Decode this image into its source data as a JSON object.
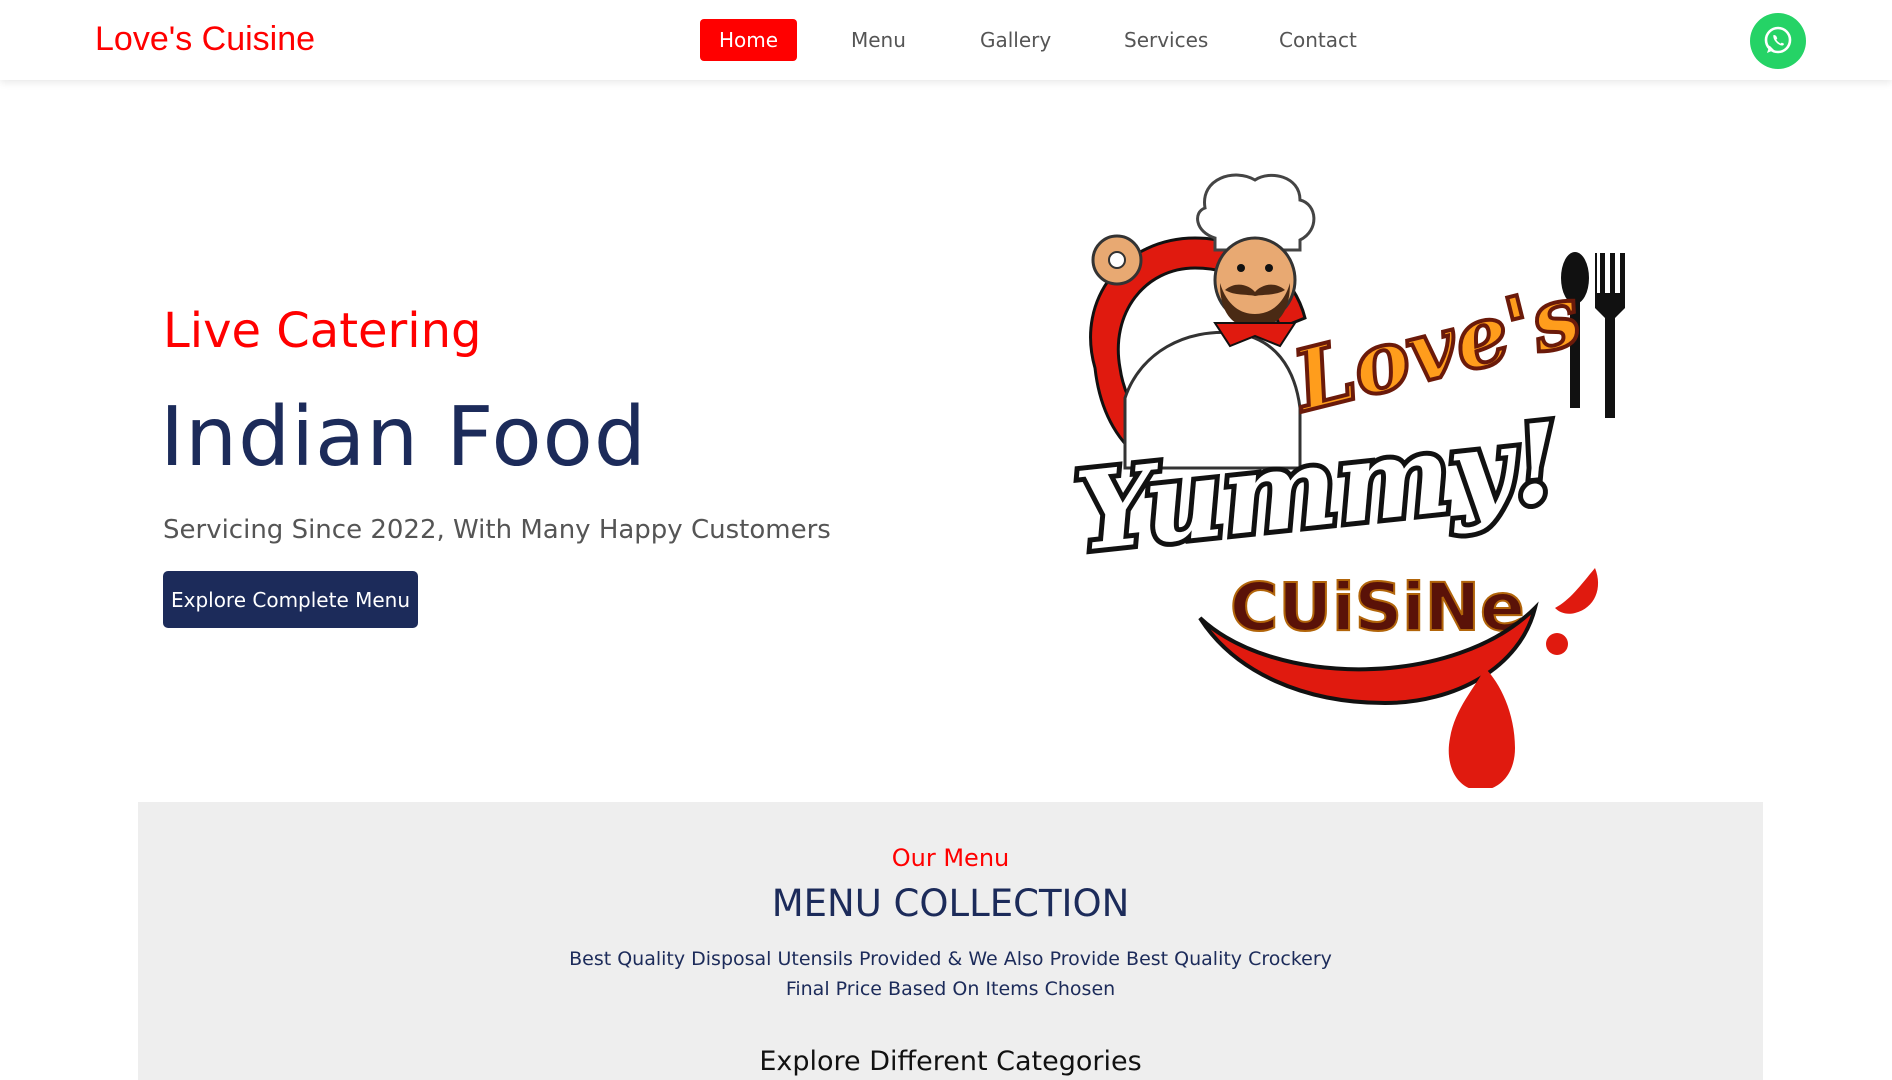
{
  "header": {
    "brand": "Love's Cuisine",
    "nav": [
      {
        "label": "Home",
        "active": true
      },
      {
        "label": "Menu",
        "active": false
      },
      {
        "label": "Gallery",
        "active": false
      },
      {
        "label": "Services",
        "active": false
      },
      {
        "label": "Contact",
        "active": false
      }
    ],
    "contact_icon": "whatsapp-icon"
  },
  "hero": {
    "subtitle": "Live Catering",
    "title": "Indian Food",
    "tagline": "Servicing Since 2022, With Many Happy Customers",
    "cta_label": "Explore Complete Menu",
    "logo": {
      "line1": "Love's",
      "line2": "Yummy!",
      "line3": "CUiSiNe"
    }
  },
  "menu_section": {
    "label": "Our Menu",
    "heading": "MENU COLLECTION",
    "description_line1": "Best Quality Disposal Utensils Provided & We Also Provide Best Quality Crockery",
    "description_line2": "Final Price Based On Items Chosen",
    "explore_heading": "Explore Different Categories"
  },
  "colors": {
    "accent": "#ff0000",
    "navy": "#1c2b5a",
    "whatsapp": "#25d366",
    "section_bg": "#eeeeee"
  }
}
